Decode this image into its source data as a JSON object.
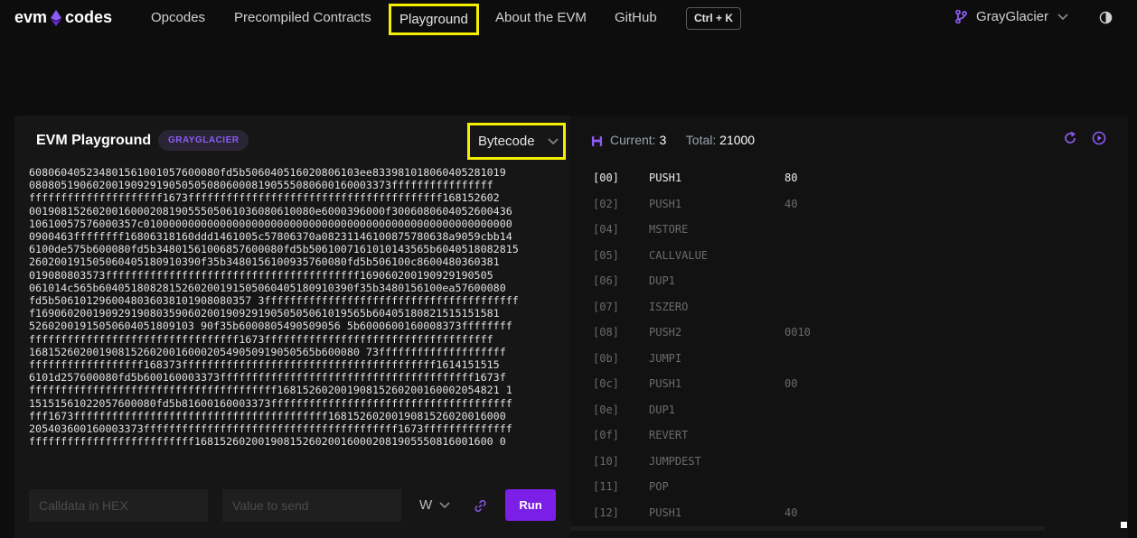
{
  "nav": {
    "logo_left": "evm",
    "logo_right": "codes",
    "links": [
      "Opcodes",
      "Precompiled Contracts",
      "Playground",
      "About the EVM",
      "GitHub"
    ],
    "shortcut": "Ctrl + K",
    "fork": "GrayGlacier"
  },
  "colors": {
    "accent": "#7c1fe6",
    "highlight": "#f5ef00"
  },
  "playground": {
    "title": "EVM Playground",
    "fork_badge": "GRAYGLACIER",
    "mode": "Bytecode",
    "bytecode_lines": [
      "608060405234801561001057600080fd5b506040516020806103ee833981018060405281019",
      "080805190602001909291905050508060008190555080600160003373ffffffffffffffff",
      "fffffffffffffffffffff1673ffffffffffffffffffffffffffffffffffffffff168152602",
      "001908152602001600020819055505061036080610080e6000396000f3006080604052600436",
      "10610057576000357c0100000000000000000000000000000000000000000000000000000000",
      "0900463ffffffff16806318160ddd1461005c57806370a08231146100875780638a9059cbb14",
      "6100de575b600080fd5b34801561006857600080fd5b5061007161010143565b6040518082815",
      "260200191505060405180910390f35b3480156100935760080fd5b506100c8600480360381",
      "019080803573ffffffffffffffffffffffffffffffffffffffff169060200190929190505",
      "061014c565b6040518082815260200191505060405180910390f35b3480156100ea57600080",
      "fd5b5061012960048036038101908080357 3ffffffffffffffffffffffffffffffffffffffff",
      "f1690602001909291908035906020019092919050505061019565b60405180821515151581",
      "52602001915050604051809103 90f35b6000805490509056 5b6000600160008373ffffffff",
      "fffffffffffffffffffffffffffffffff1673ffffffffffffffffffffffffffffffffffff",
      "168152602001908152602001600020549050919050565b600080 73ffffffffffffffffffff",
      "ffffffffffffffffff168373ffffffffffffffffffffffffffffffffffffffff1614151515",
      "6101d257600080fd5b600160003373ffffffffffffffffffffffffffffffffffffffff1673f",
      "fffffffffffffffffffffffffffffffffffffff16815260200190815260200160002054821 1",
      "15151561022057600080fd5b81600160003373ffffffffffffffffffffffffffffffffffffff",
      "fff1673ffffffffffffffffffffffffffffffffffffffff1681526020019081526020016000",
      "205403600160003373ffffffffffffffffffffffffffffffffffffffff1673ffffffffffffff",
      "ffffffffffffffffffffffffff16815260200190815260200160002081905550816001600 0"
    ],
    "calldata_placeholder": "Calldata in HEX",
    "value_placeholder": "Value to send",
    "unit": "W",
    "run_label": "Run"
  },
  "execution": {
    "current_label": "Current:",
    "current_value": "3",
    "total_label": "Total:",
    "total_value": "21000",
    "opcodes": [
      {
        "pc": "[00]",
        "name": "PUSH1",
        "value": "80",
        "active": true
      },
      {
        "pc": "[02]",
        "name": "PUSH1",
        "value": "40"
      },
      {
        "pc": "[04]",
        "name": "MSTORE",
        "value": ""
      },
      {
        "pc": "[05]",
        "name": "CALLVALUE",
        "value": ""
      },
      {
        "pc": "[06]",
        "name": "DUP1",
        "value": ""
      },
      {
        "pc": "[07]",
        "name": "ISZERO",
        "value": ""
      },
      {
        "pc": "[08]",
        "name": "PUSH2",
        "value": "0010"
      },
      {
        "pc": "[0b]",
        "name": "JUMPI",
        "value": ""
      },
      {
        "pc": "[0c]",
        "name": "PUSH1",
        "value": "00"
      },
      {
        "pc": "[0e]",
        "name": "DUP1",
        "value": ""
      },
      {
        "pc": "[0f]",
        "name": "REVERT",
        "value": ""
      },
      {
        "pc": "[10]",
        "name": "JUMPDEST",
        "value": ""
      },
      {
        "pc": "[11]",
        "name": "POP",
        "value": ""
      },
      {
        "pc": "[12]",
        "name": "PUSH1",
        "value": "40"
      }
    ]
  }
}
